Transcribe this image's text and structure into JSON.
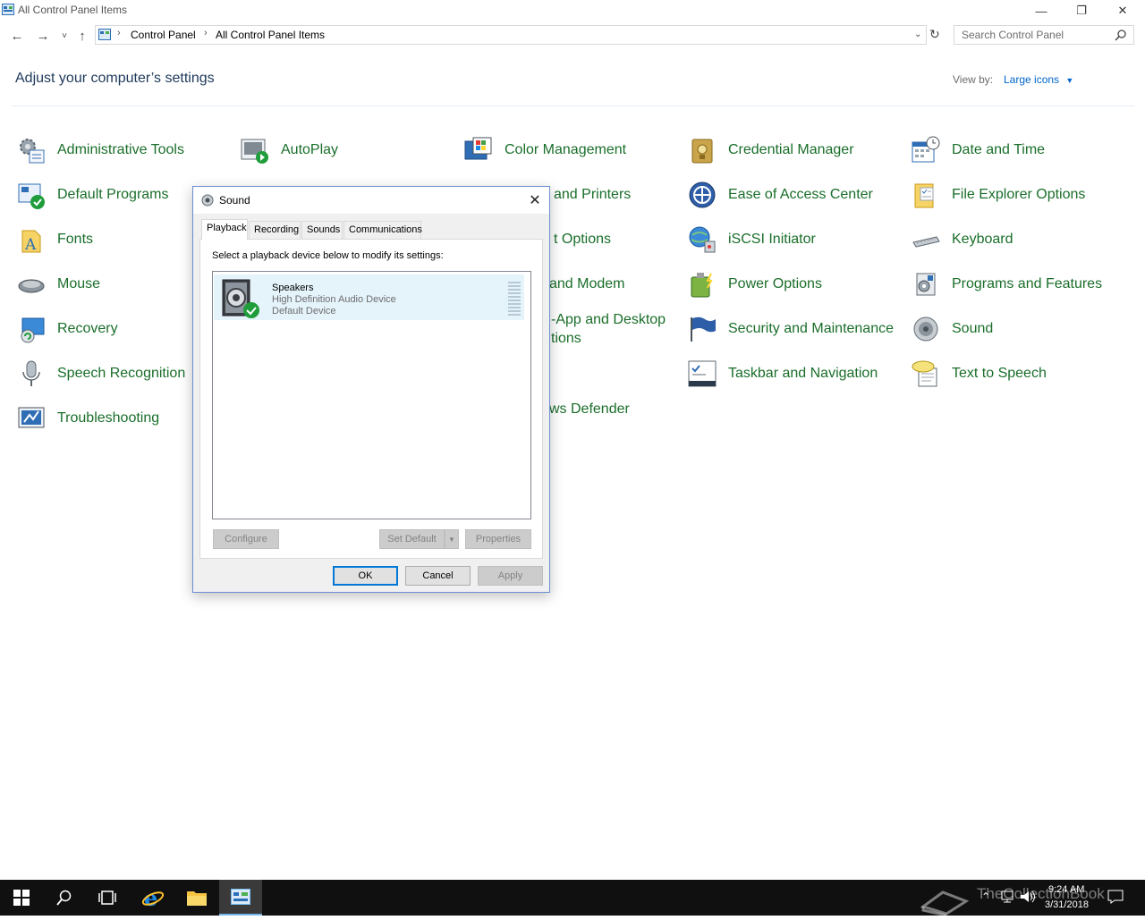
{
  "window": {
    "title": "All Control Panel Items",
    "minimize_icon": "minimize-icon",
    "maximize_icon": "restore-icon",
    "close_icon": "close-icon"
  },
  "address": {
    "breadcrumb": [
      "Control Panel",
      "All Control Panel Items"
    ],
    "search_placeholder": "Search Control Panel"
  },
  "header": {
    "title": "Adjust your computer’s settings",
    "view_by_label": "View by:",
    "view_by_value": "Large icons"
  },
  "items": [
    {
      "label": "Administrative Tools"
    },
    {
      "label": "AutoPlay"
    },
    {
      "label": "Color Management"
    },
    {
      "label": "Credential Manager"
    },
    {
      "label": "Date and Time"
    },
    {
      "label": "Default Programs"
    },
    {
      "label": "Ease of Access Center"
    },
    {
      "label": "File Explorer Options"
    },
    {
      "label": "Fonts"
    },
    {
      "label": "iSCSI Initiator"
    },
    {
      "label": "Keyboard"
    },
    {
      "label": "Mouse"
    },
    {
      "label": "Power Options"
    },
    {
      "label": "Programs and Features"
    },
    {
      "label": "Recovery"
    },
    {
      "label": "Security and Maintenance"
    },
    {
      "label": "Sound"
    },
    {
      "label": "Speech Recognition"
    },
    {
      "label": "Taskbar and Navigation"
    },
    {
      "label": "Text to Speech"
    },
    {
      "label": "Troubleshooting"
    }
  ],
  "partial_items": [
    "and Printers",
    "t Options",
    "and Modem",
    "-App and Desktop",
    "tions",
    "ws Defender"
  ],
  "dialog": {
    "title": "Sound",
    "tabs": [
      "Playback",
      "Recording",
      "Sounds",
      "Communications"
    ],
    "instruction": "Select a playback device below to modify its settings:",
    "device": {
      "name": "Speakers",
      "description": "High Definition Audio Device",
      "status": "Default Device"
    },
    "buttons": {
      "configure": "Configure",
      "set_default": "Set Default",
      "properties": "Properties",
      "ok": "OK",
      "cancel": "Cancel",
      "apply": "Apply"
    }
  },
  "taskbar": {
    "time": "9:24 AM",
    "date": "3/31/2018",
    "watermark": "TheCollectionBook"
  }
}
